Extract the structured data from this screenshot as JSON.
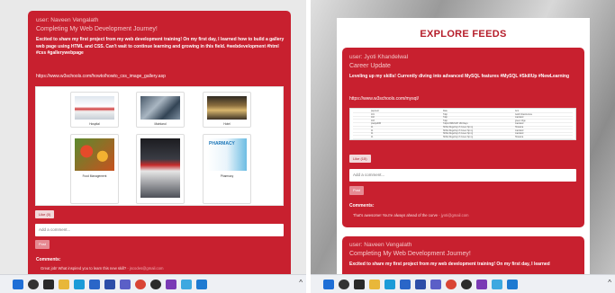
{
  "left": {
    "post": {
      "user": "user: Naveen Vengalath",
      "title": "Completing My Web Development Journey!",
      "text": "Excited to share my first project from my web development training! On my first day, I learned how to build a gallery web page using HTML and CSS. Can't wait to continue learning and growing in this field. #webdevelopment #html #css #gallerywebpage",
      "link": "https://www.w3schools.com/howto/howto_css_image_gallery.asp",
      "gallery": [
        {
          "caption": "Hospital",
          "image": "hospital-image"
        },
        {
          "caption": "Mainland",
          "image": "medical-team-image"
        },
        {
          "caption": "Hotel",
          "image": "hotel-lobby-image"
        },
        {
          "caption": "Food Management",
          "image": "food-image"
        },
        {
          "caption": "",
          "image": "fuel-station-image"
        },
        {
          "caption": "Pharmacy",
          "image": "pharmacy-image"
        }
      ],
      "like_label": "Like (0)",
      "comment_placeholder": "Add a comment...",
      "post_button": "Post",
      "comments_label": "Comments:",
      "comments": [
        {
          "text": "Great job! What inspired you to learn this new skill?",
          "author": "- jscodes@gmail.com"
        }
      ]
    }
  },
  "right": {
    "page_title": "EXPLORE FEEDS",
    "post": {
      "user": "user: Jyoti Khandelwal",
      "title": "Career Update",
      "text": "Leveling up my skills! Currently diving into advanced MySQL features #MySQL #SkillUp #NewLearning",
      "link": "https://www.w3schools.com/mysql/",
      "table": {
        "headers": [
          "payment",
          "Date",
          "Amt"
        ],
        "rows": [
          [
            "101",
            "Tulip",
            "Gold Infrastructure"
          ],
          [
            "102",
            "Tulip",
            "mainland"
          ],
          [
            "103",
            "Tulip",
            "green ridge"
          ],
          [
            "pradyotNB",
            "Tullpin BRUNCH 180 Days",
            "mainland"
          ],
          [
            "11",
            "Shiflet Regel Eys 6 Green Sp ng",
            "Hosanna"
          ],
          [
            "11",
            "Shiflet Regel Eys 6 Green Sp ng",
            "mainland"
          ],
          [
            "11",
            "Shiflet Regel Eys 6 Green Sp ng",
            "mainland"
          ],
          [
            "11",
            "Shiflet Regel Eys 6 Green Sp ng",
            "Hosanna"
          ]
        ]
      },
      "like_label": "Like (15)",
      "comment_placeholder": "Add a comment...",
      "post_button": "Post",
      "comments_label": "Comments:",
      "comments": [
        {
          "text": "That's awesome! You're always ahead of the curve",
          "author": "- jyoti@gmail.com"
        }
      ]
    },
    "next_post": {
      "user": "user: Naveen Vengalath",
      "title": "Completing My Web Development Journey!",
      "text": "Excited to share my first project from my web development training! On my first day, I learned"
    }
  },
  "taskbar": {
    "chevron": "^",
    "icons": [
      "windows-start",
      "search",
      "task-view",
      "explorer",
      "edge",
      "mail",
      "store",
      "teams",
      "chrome",
      "obs",
      "media",
      "notepad",
      "vscode"
    ],
    "colors": {
      "windows-start": "#1f6fd6",
      "search": "#333333",
      "task-view": "#2a2a2a",
      "explorer": "#e8b73a",
      "edge": "#1b9bd8",
      "mail": "#2a66c8",
      "store": "#2d4ea8",
      "teams": "#5b5fc7",
      "chrome": "#d94434",
      "obs": "#2b2b2b",
      "media": "#7a3ab5",
      "notepad": "#3da8e0",
      "vscode": "#1e7ad1"
    }
  },
  "colors": {
    "card_red": "#c8202f",
    "accent_red": "#b51d2a",
    "post_button_pink": "#e68a93"
  }
}
